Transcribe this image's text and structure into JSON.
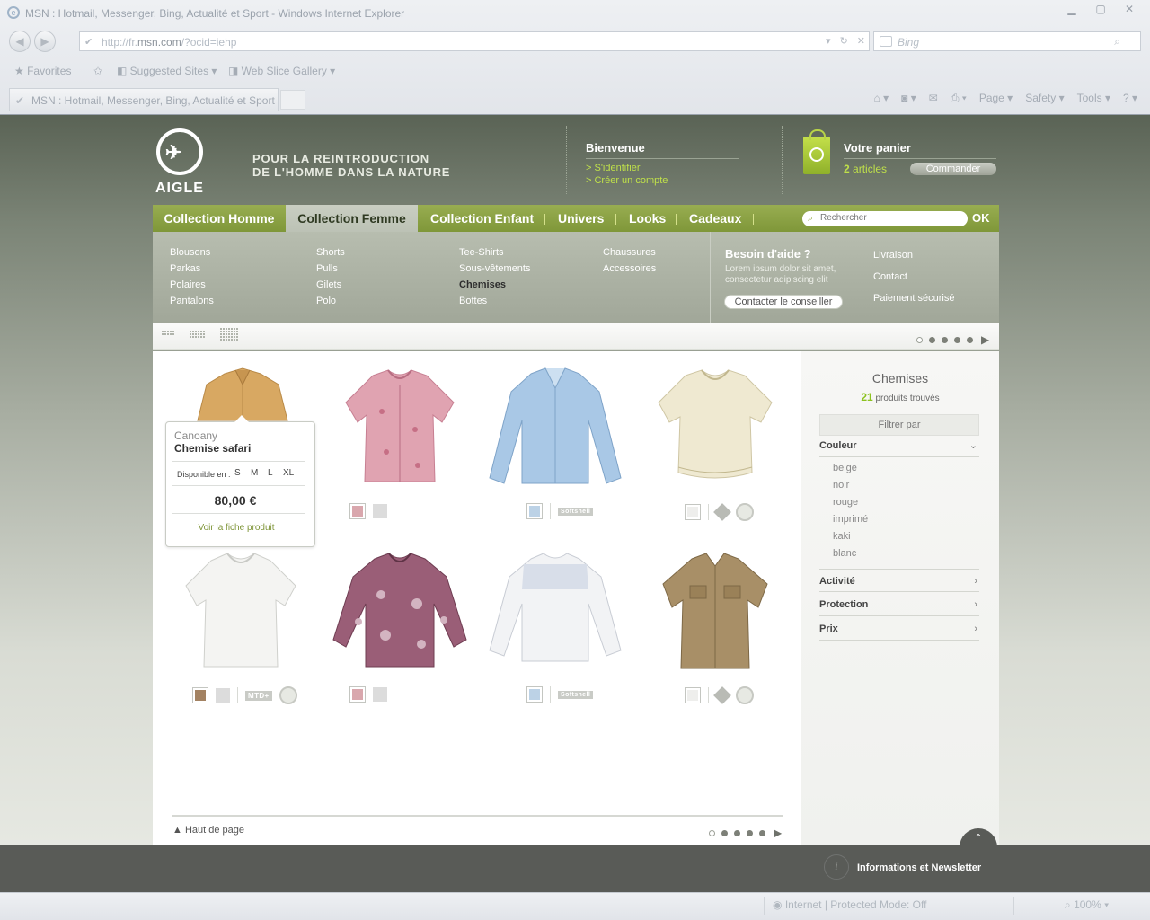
{
  "browser": {
    "window_title": "MSN : Hotmail, Messenger, Bing, Actualité et Sport - Windows Internet Explorer",
    "url_prefix": "http://fr.",
    "url_domain": "msn.com",
    "url_suffix": "/?ocid=iehp",
    "search_placeholder": "Bing",
    "favorites_label": "Favorites",
    "suggested_sites": "Suggested Sites",
    "web_slice": "Web Slice Gallery",
    "tab_title": "MSN : Hotmail, Messenger, Bing, Actualité et Sport",
    "cmd_page": "Page",
    "cmd_safety": "Safety",
    "cmd_tools": "Tools",
    "status_zone": "Internet | Protected Mode: Off",
    "zoom": "100%"
  },
  "header": {
    "brand": "AIGLE",
    "tagline_1": "POUR LA REINTRODUCTION",
    "tagline_2": "DE L'HOMME DANS LA NATURE",
    "welcome_title": "Bienvenue",
    "login_link": "> S'identifier",
    "create_link": "> Créer un compte",
    "cart_title": "Votre panier",
    "cart_count": "2",
    "cart_unit": "articles",
    "order_button": "Commander"
  },
  "nav": {
    "items": [
      "Collection Homme",
      "Collection Femme",
      "Collection Enfant",
      "Univers",
      "Looks",
      "Cadeaux"
    ],
    "search_placeholder": "Rechercher",
    "search_button": "OK"
  },
  "submenu": {
    "col1": [
      "Blousons",
      "Parkas",
      "Polaires",
      "Pantalons"
    ],
    "col2": [
      "Shorts",
      "Pulls",
      "Gilets",
      "Polo"
    ],
    "col3": [
      "Tee-Shirts",
      "Sous-vêtements",
      "Chemises",
      "Bottes"
    ],
    "col4": [
      "Chaussures",
      "Accessoires"
    ],
    "help_title": "Besoin d'aide ?",
    "help_text": "Lorem ipsum dolor sit amet, consectetur adipiscing elit",
    "help_button": "Contacter le conseiller",
    "links": [
      "Livraison",
      "Contact",
      "Paiement sécurisé"
    ]
  },
  "popup": {
    "brand": "Canoany",
    "name": "Chemise safari",
    "available_label": "Disponible en  :",
    "sizes": [
      "S",
      "M",
      "L",
      "XL"
    ],
    "price": "80,00 €",
    "link": "Voir la fiche produit"
  },
  "badges": {
    "softshell": "Softshell",
    "mtd": "MTD+"
  },
  "colors": {
    "accent_green": "#8fa53a",
    "lime": "#bfe04a",
    "shirt_tan": "#d8a862",
    "shirt_pink": "#d98ea0",
    "shirt_blue": "#9cc0e2",
    "shirt_cream": "#ece6cd",
    "shirt_white": "#f3f3f1",
    "shirt_mauve": "#93576f",
    "shirt_grey_white": "#dfe3ea",
    "shirt_khaki": "#a38a63"
  },
  "footer": {
    "top_link": "Haut de page",
    "info": "Informations et Newsletter"
  },
  "sidebar": {
    "title": "Chemises",
    "count": "21",
    "count_label": "produits trouvés",
    "filter": "Filtrer par",
    "color_facet": "Couleur",
    "colors": [
      "beige",
      "noir",
      "rouge",
      "imprimé",
      "kaki",
      "blanc"
    ],
    "facets": [
      "Activité",
      "Protection",
      "Prix"
    ]
  }
}
